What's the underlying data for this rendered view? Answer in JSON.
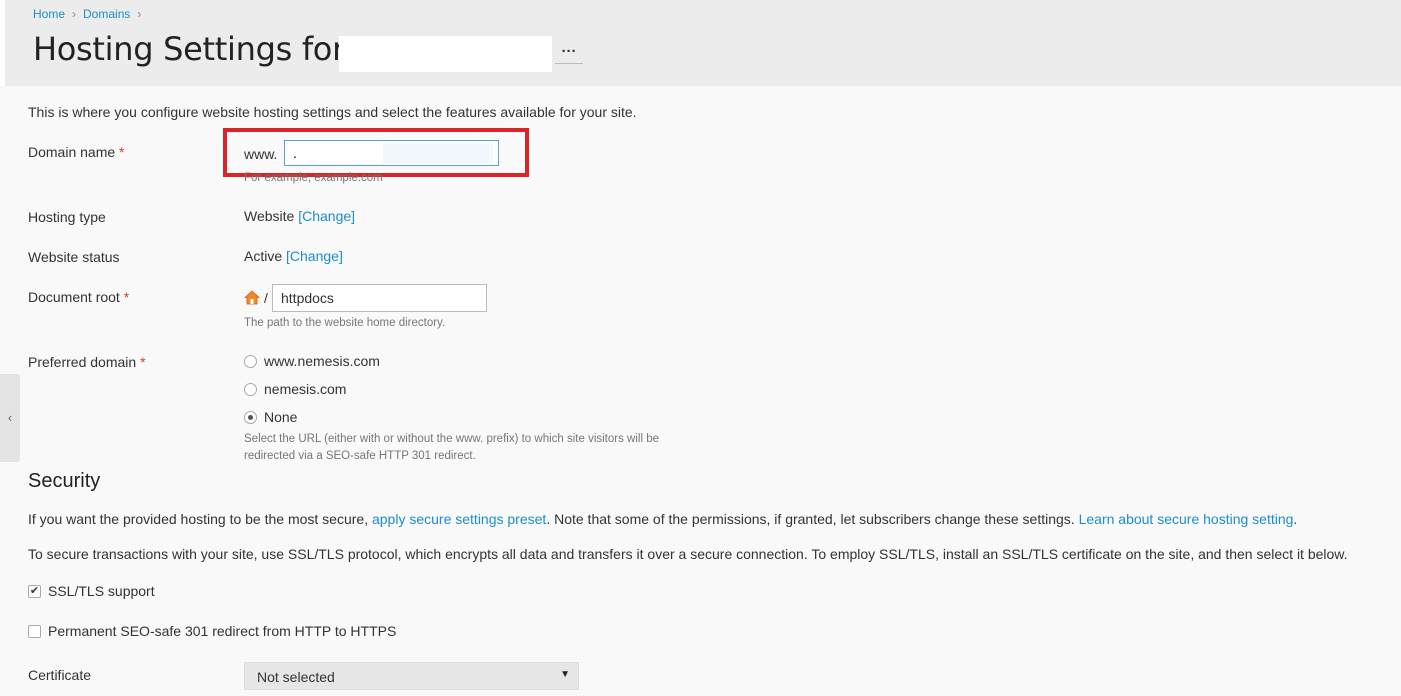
{
  "breadcrumb": {
    "home": "Home",
    "domains": "Domains",
    "sep": "›"
  },
  "title": "Hosting Settings for",
  "more_label": "···",
  "intro": "This is where you configure website hosting settings and select the features available for your site.",
  "required_mark": "*",
  "domain": {
    "label": "Domain name",
    "prefix": "www.",
    "value": ".",
    "hint": "For example, example.com"
  },
  "hosting_type": {
    "label": "Hosting type",
    "value": "Website",
    "change": "[Change]"
  },
  "website_status": {
    "label": "Website status",
    "value": "Active",
    "change": "[Change]"
  },
  "document_root": {
    "label": "Document root",
    "slash": "/",
    "value": "httpdocs",
    "hint": "The path to the website home directory."
  },
  "preferred_domain": {
    "label": "Preferred domain",
    "options": [
      "www.nemesis.com",
      "nemesis.com",
      "None"
    ],
    "selected": "None",
    "hint_line1": "Select the URL (either with or without the www. prefix) to which site visitors will be",
    "hint_line2": "redirected via a SEO-safe HTTP 301 redirect."
  },
  "security": {
    "title": "Security",
    "p1_before": "If you want the provided hosting to be the most secure, ",
    "p1_link1": "apply secure settings preset",
    "p1_middle": ". Note that some of the permissions, if granted, let subscribers change these settings. ",
    "p1_link2": "Learn about secure hosting setting",
    "p1_after": ".",
    "p2": "To secure transactions with your site, use SSL/TLS protocol, which encrypts all data and transfers it over a secure connection. To employ SSL/TLS, install an SSL/TLS certificate on the site, and then select it below.",
    "ssl_label": "SSL/TLS support",
    "ssl_checked": true,
    "redirect_label": "Permanent SEO-safe 301 redirect from HTTP to HTTPS",
    "redirect_checked": false,
    "certificate_label": "Certificate",
    "certificate_value": "Not selected"
  },
  "colors": {
    "link": "#1b8ecc",
    "required": "#d13d2a",
    "highlight": "#d9242c"
  }
}
